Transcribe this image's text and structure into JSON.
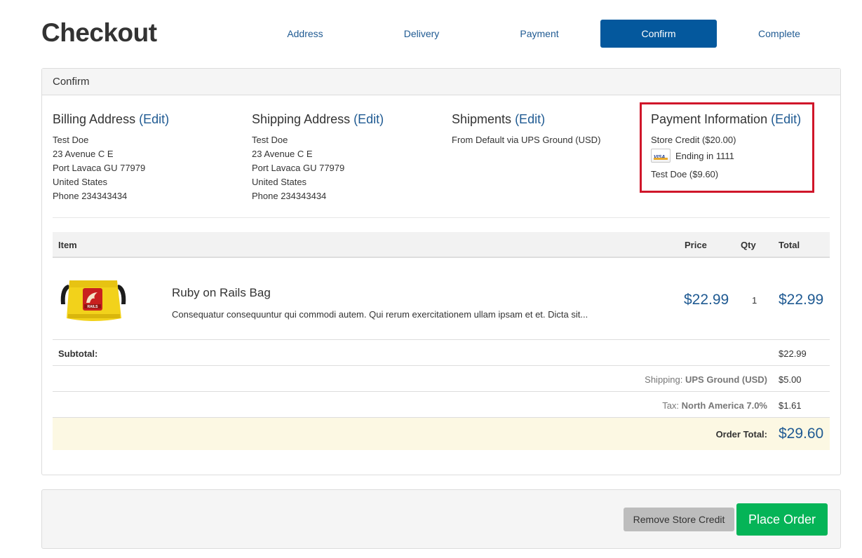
{
  "page": {
    "title": "Checkout"
  },
  "steps": [
    {
      "label": "Address"
    },
    {
      "label": "Delivery"
    },
    {
      "label": "Payment"
    },
    {
      "label": "Confirm",
      "active": true
    },
    {
      "label": "Complete"
    }
  ],
  "panel": {
    "heading": "Confirm"
  },
  "billing": {
    "title": "Billing Address",
    "edit": "(Edit)",
    "lines": [
      "Test Doe",
      "23 Avenue C E",
      "Port Lavaca GU 77979",
      "United States",
      "Phone 234343434"
    ]
  },
  "shipping": {
    "title": "Shipping Address",
    "edit": "(Edit)",
    "lines": [
      "Test Doe",
      "23 Avenue C E",
      "Port Lavaca GU 77979",
      "United States",
      "Phone 234343434"
    ]
  },
  "shipments": {
    "title": "Shipments",
    "edit": "(Edit)",
    "lines": [
      "From Default via UPS Ground (USD)"
    ]
  },
  "payment": {
    "title": "Payment Information",
    "edit": "(Edit)",
    "store_credit": "Store Credit ($20.00)",
    "card_icon": "visa-card-icon",
    "card_brand": "VISA",
    "card_ending": "Ending in 1111",
    "card_amount": "Test Doe ($9.60)"
  },
  "items_table": {
    "headers": {
      "item": "Item",
      "price": "Price",
      "qty": "Qty",
      "total": "Total"
    },
    "rows": [
      {
        "image": "rails-bag-image",
        "name": "Ruby on Rails Bag",
        "description": "Consequatur consequuntur qui commodi autem. Qui rerum exercitationem ullam ipsam et et. Dicta sit...",
        "price": "$22.99",
        "qty": "1",
        "total": "$22.99"
      }
    ]
  },
  "summary": {
    "subtotal_label": "Subtotal:",
    "subtotal_value": "$22.99",
    "shipping_prefix": "Shipping:",
    "shipping_method": "UPS Ground (USD)",
    "shipping_value": "$5.00",
    "tax_prefix": "Tax:",
    "tax_name": "North America 7.0%",
    "tax_value": "$1.61",
    "order_total_label": "Order Total:",
    "order_total_value": "$29.60"
  },
  "actions": {
    "remove_store_credit": "Remove Store Credit",
    "place_order": "Place Order"
  },
  "colors": {
    "link": "#1f5a92",
    "active_step": "#04589d",
    "place_order": "#05b457",
    "highlight_border": "#d0162a",
    "order_total_bg": "#fcf8e3"
  }
}
